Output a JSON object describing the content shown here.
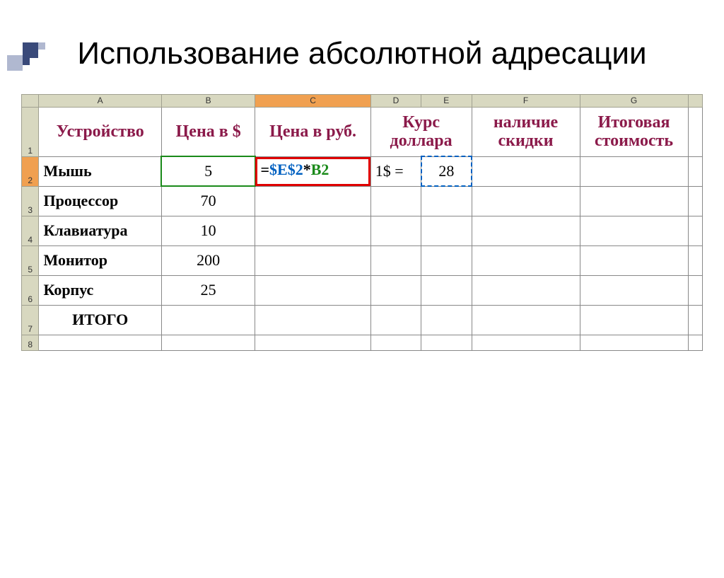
{
  "slide": {
    "title": "Использование абсолютной адресации"
  },
  "columns": [
    "A",
    "B",
    "C",
    "D",
    "E",
    "F",
    "G"
  ],
  "selected_col": "C",
  "selected_row": "2",
  "row_nums": [
    "1",
    "2",
    "3",
    "4",
    "5",
    "6",
    "7",
    "8"
  ],
  "headers": {
    "A": "Устройство",
    "B": "Цена в $",
    "C": "Цена в руб.",
    "DE": "Курс доллара",
    "F": "наличие скидки",
    "G": "Итоговая стоимость"
  },
  "rows": [
    {
      "label": "Мышь",
      "price": "5",
      "d": "1$ =",
      "e": "28"
    },
    {
      "label": "Процессор",
      "price": "70",
      "d": "",
      "e": ""
    },
    {
      "label": "Клавиатура",
      "price": "10",
      "d": "",
      "e": ""
    },
    {
      "label": "Монитор",
      "price": "200",
      "d": "",
      "e": ""
    },
    {
      "label": "Корпус",
      "price": "25",
      "d": "",
      "e": ""
    },
    {
      "label": "ИТОГО",
      "price": "",
      "d": "",
      "e": ""
    }
  ],
  "formula": {
    "eq": "=",
    "abs": "$E$2",
    "op": "*",
    "rel": "B2"
  },
  "chart_data": {
    "type": "table",
    "title": "Использование абсолютной адресации",
    "columns": [
      "Устройство",
      "Цена в $",
      "Цена в руб.",
      "Курс доллара (метка)",
      "Курс доллара (значение)",
      "наличие скидки",
      "Итоговая стоимость"
    ],
    "rows": [
      [
        "Мышь",
        5,
        "=$E$2*B2",
        "1$ =",
        28,
        "",
        ""
      ],
      [
        "Процессор",
        70,
        "",
        "",
        "",
        "",
        ""
      ],
      [
        "Клавиатура",
        10,
        "",
        "",
        "",
        "",
        ""
      ],
      [
        "Монитор",
        200,
        "",
        "",
        "",
        "",
        ""
      ],
      [
        "Корпус",
        25,
        "",
        "",
        "",
        "",
        ""
      ],
      [
        "ИТОГО",
        "",
        "",
        "",
        "",
        "",
        ""
      ]
    ]
  }
}
